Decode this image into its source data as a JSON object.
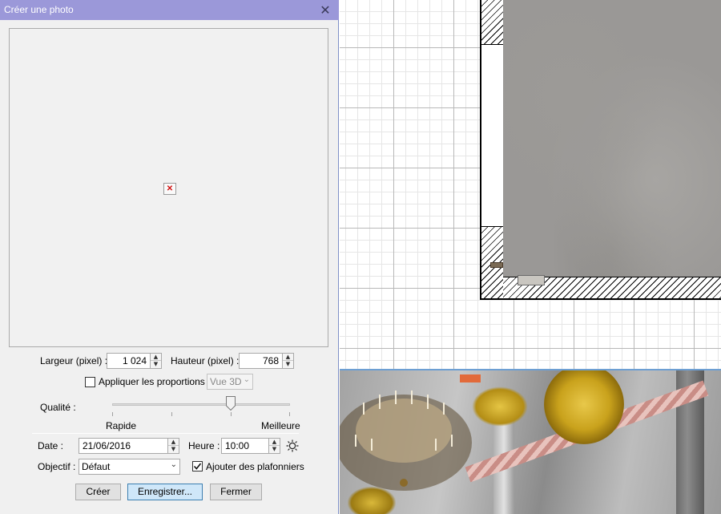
{
  "dialog": {
    "title": "Créer une photo",
    "close_glyph": "✕",
    "preview": {
      "broken_image_glyph": "✕"
    },
    "width_label": "Largeur (pixel) :",
    "width_value": "1 024",
    "height_label": "Hauteur (pixel) :",
    "height_value": "768",
    "proportions_label": "Appliquer les proportions :",
    "proportions_checked": false,
    "proportions_combo": "Vue 3D",
    "quality_label": "Qualité :",
    "quality_min_label": "Rapide",
    "quality_max_label": "Meilleure",
    "quality_level": 0.667,
    "date_label": "Date :",
    "date_value": "21/06/2016",
    "time_label": "Heure :",
    "time_value": "10:00",
    "objective_label": "Objectif :",
    "objective_value": "Défaut",
    "ceiling_lights_label": "Ajouter des plafonniers",
    "ceiling_lights_checked": true,
    "buttons": {
      "create": "Créer",
      "save": "Enregistrer...",
      "close": "Fermer"
    }
  },
  "colors": {
    "titlebar": "#9b98d9",
    "default_button": "#cfe7f9",
    "pane_divider": "#6d9fd3"
  },
  "icons": {
    "close": "close-icon",
    "sun": "sun-icon",
    "spin_up": "chevron-up-icon",
    "spin_down": "chevron-down-icon",
    "check": "checkmark-icon"
  }
}
